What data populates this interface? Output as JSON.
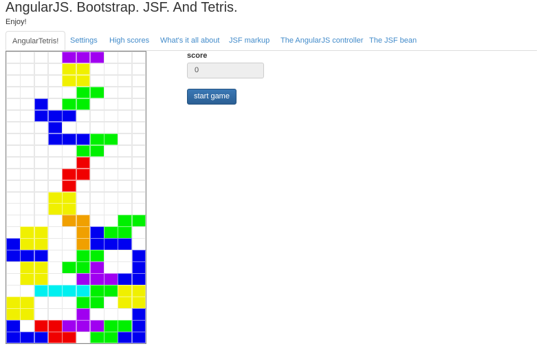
{
  "header": {
    "title": "AngularJS. Bootstrap. JSF. And Tetris.",
    "subtitle": "Enjoy!"
  },
  "tabs": [
    {
      "label": "AngularTetris!",
      "active": true
    },
    {
      "label": "Settings"
    },
    {
      "label": "High scores"
    },
    {
      "label": "What's it all about"
    },
    {
      "label": "JSF markup"
    },
    {
      "label": "The AngularJS controller"
    },
    {
      "label": "The JSF bean"
    }
  ],
  "score": {
    "label": "score",
    "value": "0"
  },
  "start_button": {
    "label": "start game"
  },
  "colors": {
    "P": "#a000f0",
    "Y": "#f0f000",
    "G": "#00f000",
    "B": "#0000f0",
    "R": "#f00000",
    "O": "#f0a000",
    "C": "#00f0f0"
  },
  "board": {
    "columns": 10,
    "rows": 25,
    "grid": [
      "....PPP...",
      "....YY....",
      "....YY....",
      ".....GG...",
      "..B.GG....",
      "..BBB.....",
      "...B......",
      "...BBBGG..",
      ".....GG...",
      ".....R....",
      "....RR....",
      "....R.....",
      "...YY.....",
      "...YY.....",
      "....OO..GG",
      ".YY..OBGG.",
      "BYY..OBBB.",
      "BBB..GG..B",
      ".YY.GGP..B",
      ".YY..PPPBB",
      "..CCCCGGYY",
      "YY...GG.YY",
      "YY...P...B",
      "B.RRPPPGGB",
      "BBBRR.GGBB"
    ]
  }
}
